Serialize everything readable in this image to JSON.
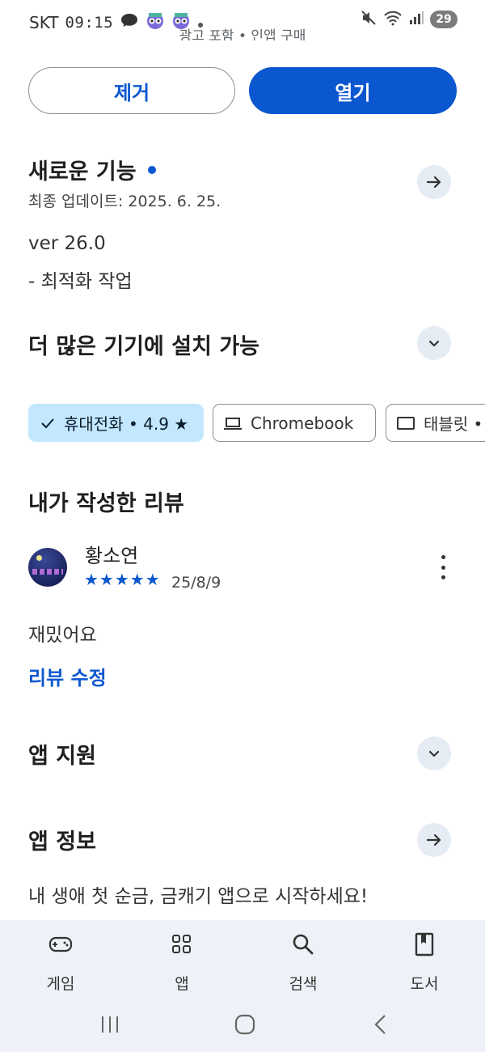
{
  "status_bar": {
    "carrier": "SKT",
    "time": "09:15",
    "battery": "29"
  },
  "header_cut_text": "광고 포함 • 인앱 구매",
  "actions": {
    "remove_label": "제거",
    "open_label": "열기"
  },
  "whats_new": {
    "title": "새로운 기능",
    "updated": "최종 업데이트: 2025. 6. 25.",
    "version": "ver 26.0",
    "notes": "- 최적화 작업"
  },
  "devices": {
    "title": "더 많은 기기에 설치 가능",
    "chips": [
      {
        "label": "휴대전화 • 4.9 ★",
        "icon": "check-icon",
        "selected": true
      },
      {
        "label": "Chromebook",
        "icon": "laptop-icon",
        "selected": false
      },
      {
        "label": "태블릿 •",
        "icon": "tablet-icon",
        "selected": false
      }
    ]
  },
  "my_review": {
    "title": "내가 작성한 리뷰",
    "reviewer": "황소연",
    "stars": "★★★★★",
    "rating": 5,
    "date": "25/8/9",
    "text": "재밌어요",
    "edit_label": "리뷰 수정"
  },
  "app_support": {
    "title": "앱 지원"
  },
  "app_info": {
    "title": "앱 정보",
    "description": "내 생애 첫 순금, 금캐기 앱으로 시작하세요!"
  },
  "bottom_nav": {
    "items": [
      {
        "label": "게임",
        "icon": "gamepad-icon"
      },
      {
        "label": "앱",
        "icon": "apps-grid-icon"
      },
      {
        "label": "검색",
        "icon": "search-icon"
      },
      {
        "label": "도서",
        "icon": "book-icon"
      }
    ]
  },
  "colors": {
    "accent": "#0b57d0",
    "chip_selected": "#c2e7ff",
    "round_button": "#e6ecf4",
    "nav_background": "#eef2f8"
  }
}
